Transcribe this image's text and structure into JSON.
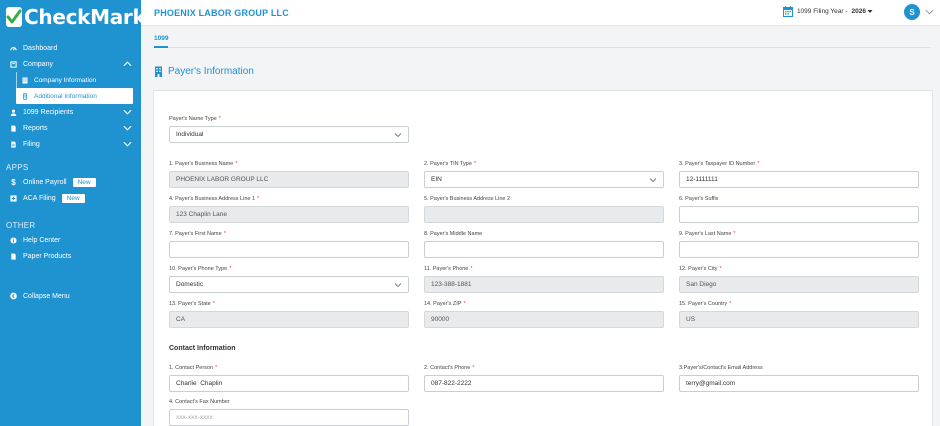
{
  "app": {
    "brand": "CheckMark"
  },
  "sidebar": {
    "items": [
      {
        "label": "Dashboard"
      },
      {
        "label": "Company"
      },
      {
        "label": "1099 Recipients"
      },
      {
        "label": "Reports"
      },
      {
        "label": "Filing"
      }
    ],
    "company_sub": [
      {
        "label": "Company Information"
      },
      {
        "label": "Additional Information"
      }
    ],
    "apps_label": "APPS",
    "apps": [
      {
        "label": "Online Payroll",
        "badge": "New"
      },
      {
        "label": "ACA Filing",
        "badge": "New"
      }
    ],
    "other_label": "OTHER",
    "other": [
      {
        "label": "Help Center"
      },
      {
        "label": "Paper Products"
      }
    ],
    "collapse_label": "Collapse Menu"
  },
  "header": {
    "company_name": "PHOENIX LABOR GROUP LLC",
    "filing_year_label": "1099 Filing Year -",
    "filing_year_value": "2026",
    "avatar_initial": "S"
  },
  "tabs": [
    {
      "label": "1099"
    }
  ],
  "page": {
    "title": "Payer's Information"
  },
  "form": {
    "name_type": {
      "label": "Payer's Name Type",
      "value": "Individual"
    },
    "business_name": {
      "label": "1. Payer's Business Name",
      "value": "PHOENIX LABOR GROUP LLC"
    },
    "tin_type": {
      "label": "2. Payer's TIN Type",
      "value": "EIN"
    },
    "tin_number": {
      "label": "3. Payer's Taxpayer ID Number",
      "value": "12-1111111"
    },
    "address1": {
      "label": "4. Payer's Business Address Line 1",
      "value": "123 Chaplin Lane"
    },
    "address2": {
      "label": "5. Payer's Business Address Line 2",
      "value": ""
    },
    "suffix": {
      "label": "6. Payer's Suffix",
      "value": ""
    },
    "first_name": {
      "label": "7. Payer's First Name",
      "value": ""
    },
    "middle_name": {
      "label": "8. Payer's Middle Name",
      "value": ""
    },
    "last_name": {
      "label": "9. Payer's Last Name",
      "value": ""
    },
    "phone_type": {
      "label": "10. Payer's Phone Type",
      "value": "Domestic"
    },
    "phone": {
      "label": "11. Payer's Phone",
      "value": "123-388-1881"
    },
    "city": {
      "label": "12. Payer's City",
      "value": "San Diego"
    },
    "state": {
      "label": "13. Payer's State",
      "value": "CA"
    },
    "zip": {
      "label": "14. Payer's ZIP",
      "value": "90000"
    },
    "country": {
      "label": "15. Payer's Country",
      "value": "US"
    },
    "contact_header": "Contact Information",
    "contact_person": {
      "label": "1. Contact Person",
      "value": "Charlie  Chaplin"
    },
    "contact_phone": {
      "label": "2. Contact's Phone",
      "value": "087-822-2222"
    },
    "contact_email": {
      "label": "3.Payer's/Contact's Email Address",
      "value": "terry@gmail.com"
    },
    "contact_fax": {
      "label": "4. Contact's Fax Number",
      "placeholder": "xxx-xxx-xxxx"
    },
    "required_mark": "*"
  },
  "colors": {
    "accent": "#1f93d0",
    "required": "#e53935"
  }
}
